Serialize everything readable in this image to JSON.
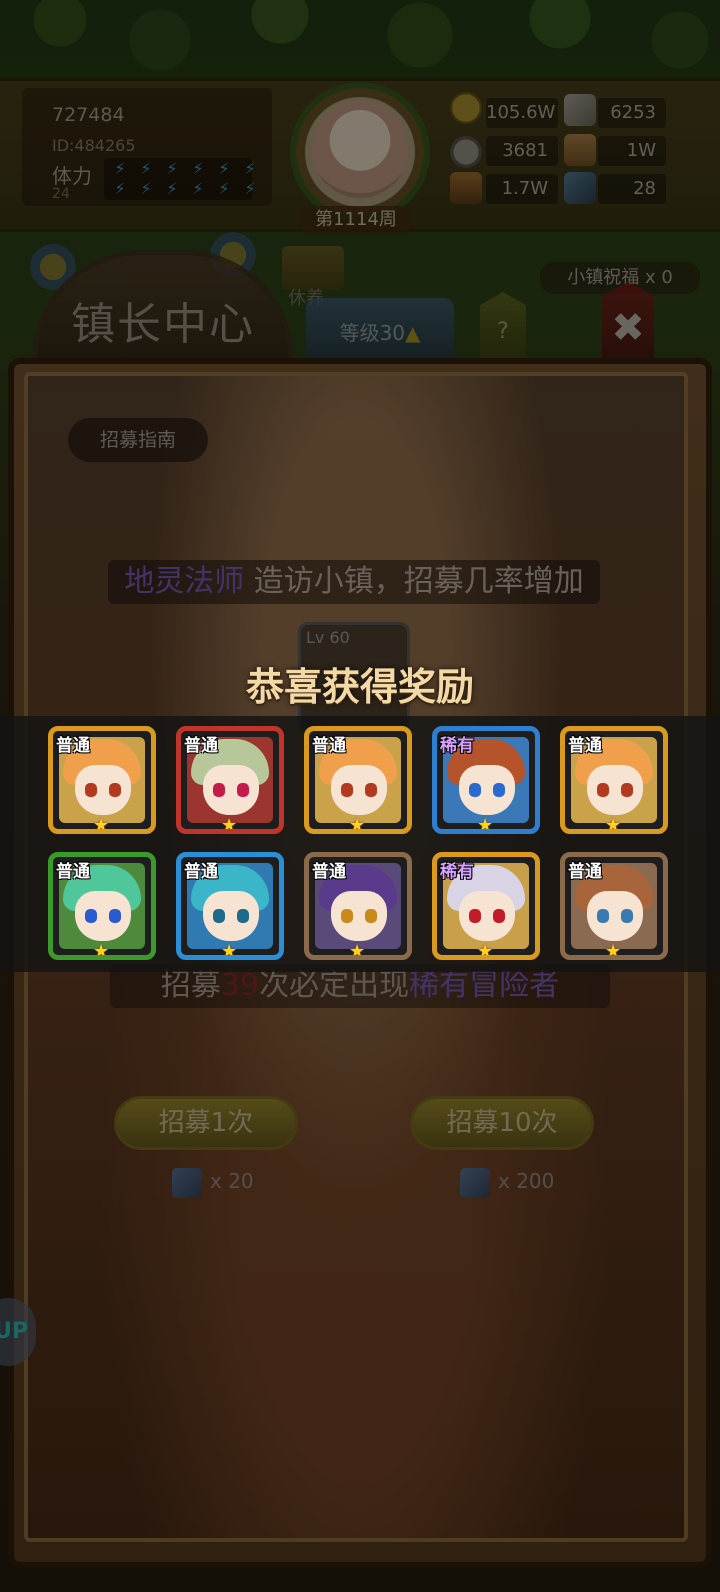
{
  "hud": {
    "player_name": "727484",
    "player_id": "ID:484265",
    "stamina_label": "体力",
    "stamina_value": "24",
    "stamina_bolts_filled": 12,
    "week_label": "第1114周",
    "resources": [
      {
        "icon": "gold-coin-icon",
        "value": "105.6W"
      },
      {
        "icon": "iron-ingot-icon",
        "value": "6253"
      },
      {
        "icon": "stone-icon",
        "value": "3681"
      },
      {
        "icon": "scroll-icon",
        "value": "1W"
      },
      {
        "icon": "wood-log-icon",
        "value": "1.7W"
      },
      {
        "icon": "blue-gem-icon",
        "value": "28"
      }
    ]
  },
  "top_bar": {
    "rest_label": "休养",
    "blessing_text": "小镇祝福 x 0"
  },
  "tabs": {
    "title": "镇长中心",
    "level_label": "等级30",
    "level_up_icon": "up-arrow-icon",
    "help_label": "?",
    "close_label": "✖"
  },
  "recruit": {
    "guide_label": "招募指南",
    "visit_hero": "地灵法师",
    "visit_text": " 造访小镇，招募几率增加",
    "lv_label": "Lv 60",
    "pity_prefix": "招募",
    "pity_count": "39",
    "pity_mid": "次必定出现",
    "pity_rarity": "稀有冒险者",
    "recruit_once_label": "招募1次",
    "recruit_ten_label": "招募10次",
    "cost_once": "x 20",
    "cost_ten": "x 200",
    "up_badge": "UP"
  },
  "popup": {
    "title": "恭喜获得奖励",
    "rewards": [
      {
        "rarity": "普通",
        "border": "#d99a1e",
        "bg": "#c9a24a",
        "hair": "#f0a04a",
        "eye": "#b23a1e",
        "stars": "★"
      },
      {
        "rarity": "普通",
        "border": "#c0342a",
        "bg": "#9a3530",
        "hair": "#b8c79a",
        "eye": "#c21c4a",
        "stars": "★"
      },
      {
        "rarity": "普通",
        "border": "#d99a1e",
        "bg": "#c9a24a",
        "hair": "#f0a04a",
        "eye": "#b23a1e",
        "stars": "★"
      },
      {
        "rarity": "稀有",
        "border": "#2f7fd0",
        "bg": "#3a78b8",
        "hair": "#b5532a",
        "eye": "#2a6ad0",
        "stars": "★"
      },
      {
        "rarity": "普通",
        "border": "#d99a1e",
        "bg": "#c9a24a",
        "hair": "#f0a04a",
        "eye": "#b23a1e",
        "stars": "★"
      },
      {
        "rarity": "普通",
        "border": "#3c9a2a",
        "bg": "#4e8a3c",
        "hair": "#4fc79a",
        "eye": "#2a5ad0",
        "stars": "★"
      },
      {
        "rarity": "普通",
        "border": "#2a8fd6",
        "bg": "#2f7ab0",
        "hair": "#3ab6c8",
        "eye": "#1e6a8a",
        "stars": "★"
      },
      {
        "rarity": "普通",
        "border": "#8a6a4a",
        "bg": "#5a4a7a",
        "hair": "#5a3a8a",
        "eye": "#c98a1a",
        "stars": "★"
      },
      {
        "rarity": "稀有",
        "border": "#d99a1e",
        "bg": "#c8a04a",
        "hair": "#d8d4e6",
        "eye": "#c21c2a",
        "stars": "★"
      },
      {
        "rarity": "普通",
        "border": "#8a6a4a",
        "bg": "#8a6a50",
        "hair": "#a8643a",
        "eye": "#3a7ab0",
        "stars": "★"
      }
    ]
  }
}
